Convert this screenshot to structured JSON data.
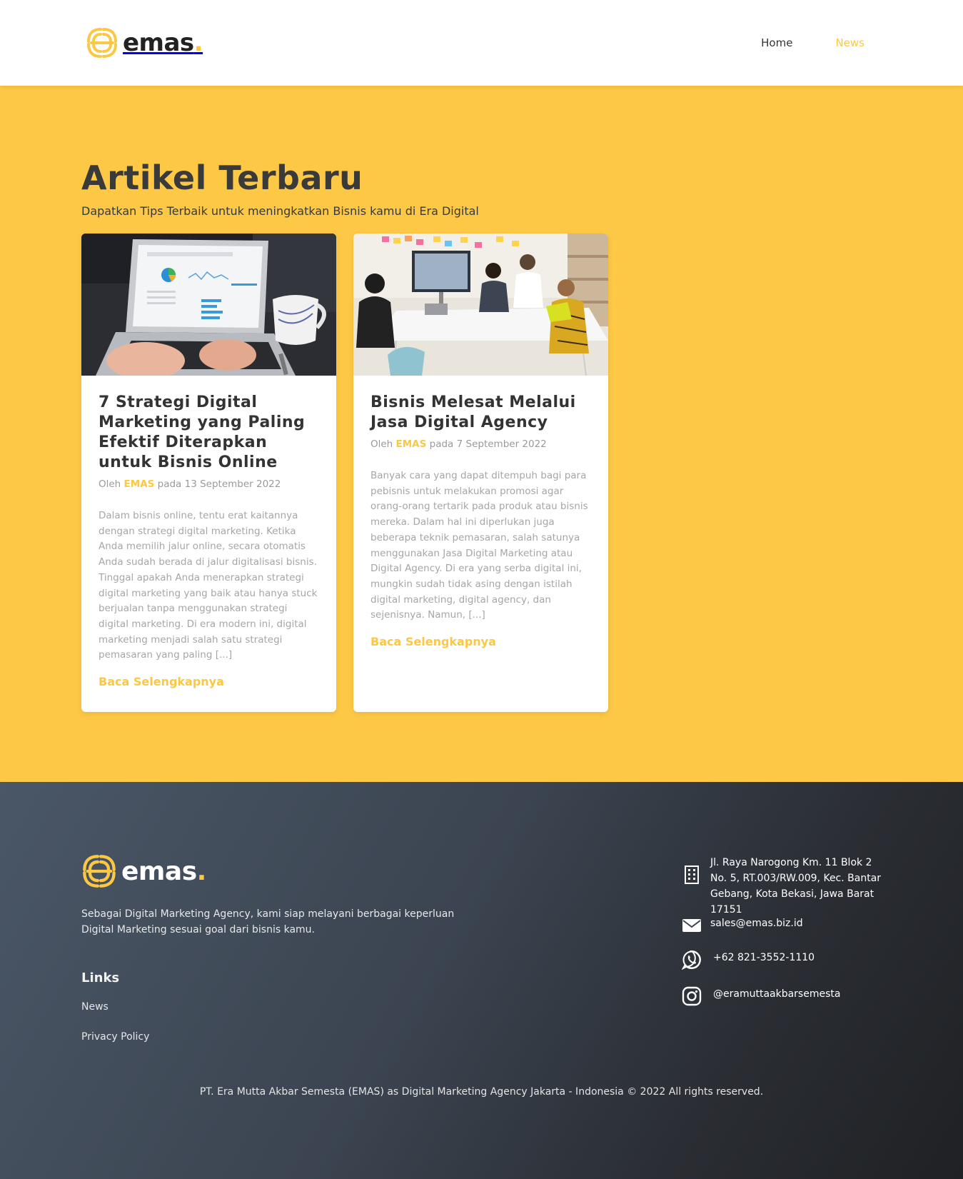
{
  "brand": {
    "name": "emas",
    "dot": ".",
    "accent_color": "#fcc844",
    "logo_icon": "emas-logo-icon"
  },
  "nav": {
    "items": [
      {
        "label": "Home",
        "active": false
      },
      {
        "label": "News",
        "active": true
      }
    ]
  },
  "hero": {
    "title": "Artikel Terbaru",
    "subtitle": "Dapatkan Tips Terbaik untuk meningkatkan Bisnis kamu di Era Digital",
    "background_color": "#fdc845"
  },
  "articles": [
    {
      "image_icon": "laptop-analytics-photo",
      "title": "7 Strategi Digital Marketing yang Paling Efektif Diterapkan untuk Bisnis Online",
      "meta_prefix": "Oleh ",
      "author": "EMAS",
      "meta_suffix": " pada 13 September 2022",
      "excerpt": "Dalam bisnis online, tentu erat kaitannya dengan strategi digital marketing. Ketika Anda memilih jalur online, secara otomatis Anda sudah berada di jalur digitalisasi bisnis. Tinggal apakah Anda menerapkan strategi digital marketing yang baik atau hanya stuck berjualan tanpa menggunakan strategi digital marketing. Di era modern ini, digital marketing menjadi salah satu strategi pemasaran yang paling [...]",
      "read_more": "Baca Selengkapnya"
    },
    {
      "image_icon": "team-meeting-photo",
      "title": "Bisnis Melesat Melalui Jasa Digital Agency",
      "meta_prefix": "Oleh ",
      "author": "EMAS",
      "meta_suffix": " pada 7 September 2022",
      "excerpt": "Banyak cara yang dapat ditempuh bagi para pebisnis untuk melakukan promosi agar orang-orang tertarik pada produk atau bisnis mereka. Dalam hal ini diperlukan juga beberapa teknik pemasaran, salah satunya menggunakan Jasa Digital Marketing atau Digital Agency. Di era yang serba digital ini, mungkin sudah tidak asing dengan istilah digital marketing, digital agency, dan sejenisnya. Namun, [...]",
      "read_more": "Baca Selengkapnya"
    }
  ],
  "footer": {
    "about": "Sebagai Digital Marketing Agency, kami siap melayani berbagai keperluan Digital Marketing sesuai goal dari bisnis kamu.",
    "links_title": "Links",
    "links": [
      "News",
      "Privacy Policy"
    ],
    "contacts": [
      {
        "icon": "building-icon",
        "text": "Jl. Raya Narogong Km. 11 Blok 2 No. 5, RT.003/RW.009, Kec. Bantar Gebang, Kota Bekasi, Jawa Barat 17151"
      },
      {
        "icon": "mail-icon",
        "text": "sales@emas.biz.id"
      },
      {
        "icon": "whatsapp-icon",
        "text": "+62 821-3552-1110"
      },
      {
        "icon": "instagram-icon",
        "text": "@eramuttaakbarsemesta"
      }
    ],
    "copyright": "PT. Era Mutta Akbar Semesta (EMAS) as Digital Marketing Agency Jakarta - Indonesia © 2022 All rights reserved."
  }
}
